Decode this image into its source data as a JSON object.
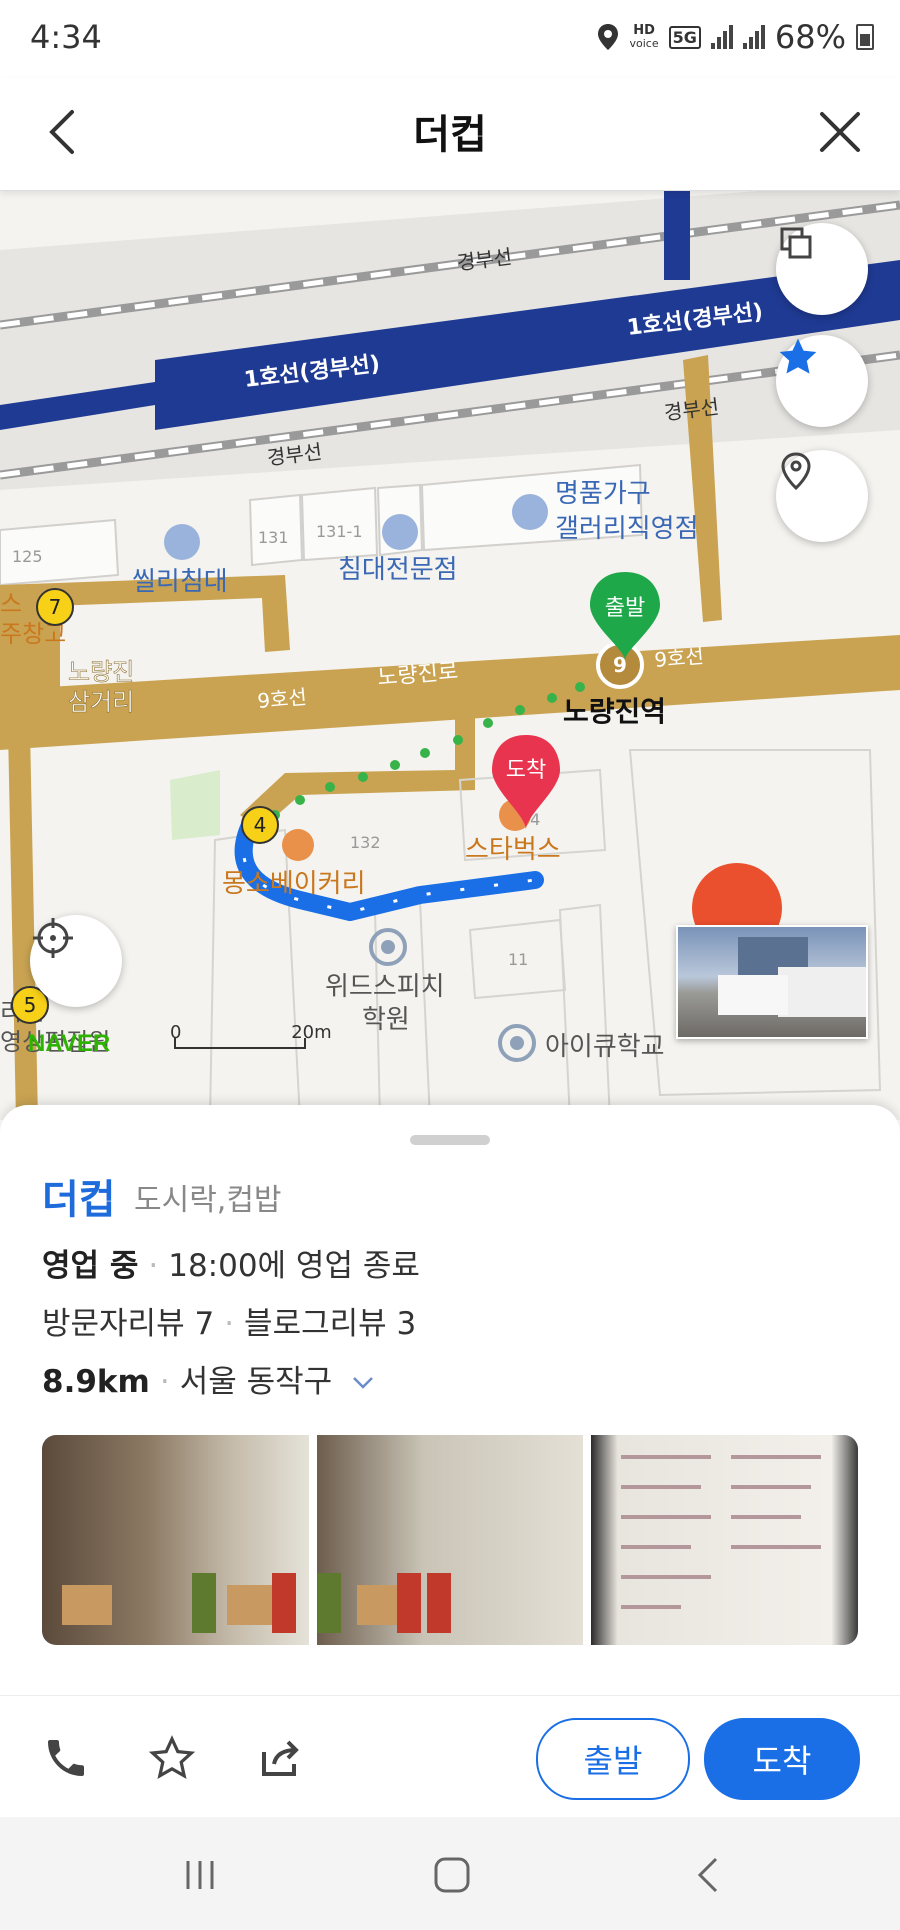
{
  "status_bar": {
    "time": "4:34",
    "hd": "HD",
    "voice": "voice",
    "network": "5G",
    "battery": "68%"
  },
  "header": {
    "title": "더컵"
  },
  "map": {
    "labels": {
      "rail1": "경부선",
      "rail2": "경부선",
      "rail3": "경부선",
      "line1a": "1호선(경부선)",
      "line1b": "1호선(경부선)",
      "store1": "명품가구",
      "store1b": "갤러리직영점",
      "bed1": "씰리침대",
      "bed2": "침대전문점",
      "intersection": "노량진",
      "intersection2": "삼거리",
      "line9a": "9호선",
      "line9b": "9호선",
      "road": "노량진로",
      "station": "노량진역",
      "starbucks": "스타벅스",
      "bakery": "몽소베이커리",
      "academy1": "위드스피치",
      "academy2": "학원",
      "school": "아이큐학교",
      "b125": "125",
      "b131": "131",
      "b1311": "131-1",
      "b132": "132",
      "b11": "11",
      "b134": "34",
      "left1": "스",
      "left2": "주창고",
      "left3": "리전",
      "left4": "영상편집원",
      "m4": "4",
      "m5": "5",
      "m7": "7",
      "m9": "9"
    },
    "markers": {
      "start": "출발",
      "dest": "도착"
    },
    "scale": {
      "zero": "0",
      "dist": "20m"
    },
    "logo": "NAVER"
  },
  "place": {
    "name": "더컵",
    "category": "도시락,컵밥",
    "status": "영업 중",
    "hours": "18:00에 영업 종료",
    "visitor_reviews": "방문자리뷰 7",
    "blog_reviews": "블로그리뷰 3",
    "distance": "8.9km",
    "region": "서울 동작구"
  },
  "actions": {
    "start": "출발",
    "dest": "도착"
  },
  "colors": {
    "accent": "#1a6fe6",
    "road": "#c9a352",
    "subway": "#1f3a93",
    "start_marker": "#1fa84a",
    "dest_marker": "#e8344e"
  }
}
